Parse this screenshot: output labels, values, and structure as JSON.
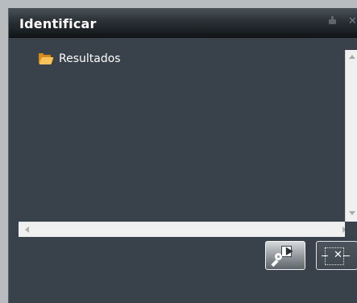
{
  "window": {
    "title": "Identificar"
  },
  "tree": {
    "items": [
      {
        "label": "Resultados",
        "icon": "open-folder-icon"
      }
    ]
  },
  "toolbar": {
    "buttons": [
      {
        "icon": "identify-icon"
      },
      {
        "icon": "clear-selection-icon"
      }
    ]
  },
  "colors": {
    "panel_background": "#39424a",
    "titlebar_dark": "#121619",
    "folder_icon": "#f6c45a",
    "scrollbar": "#f0f0f0"
  }
}
